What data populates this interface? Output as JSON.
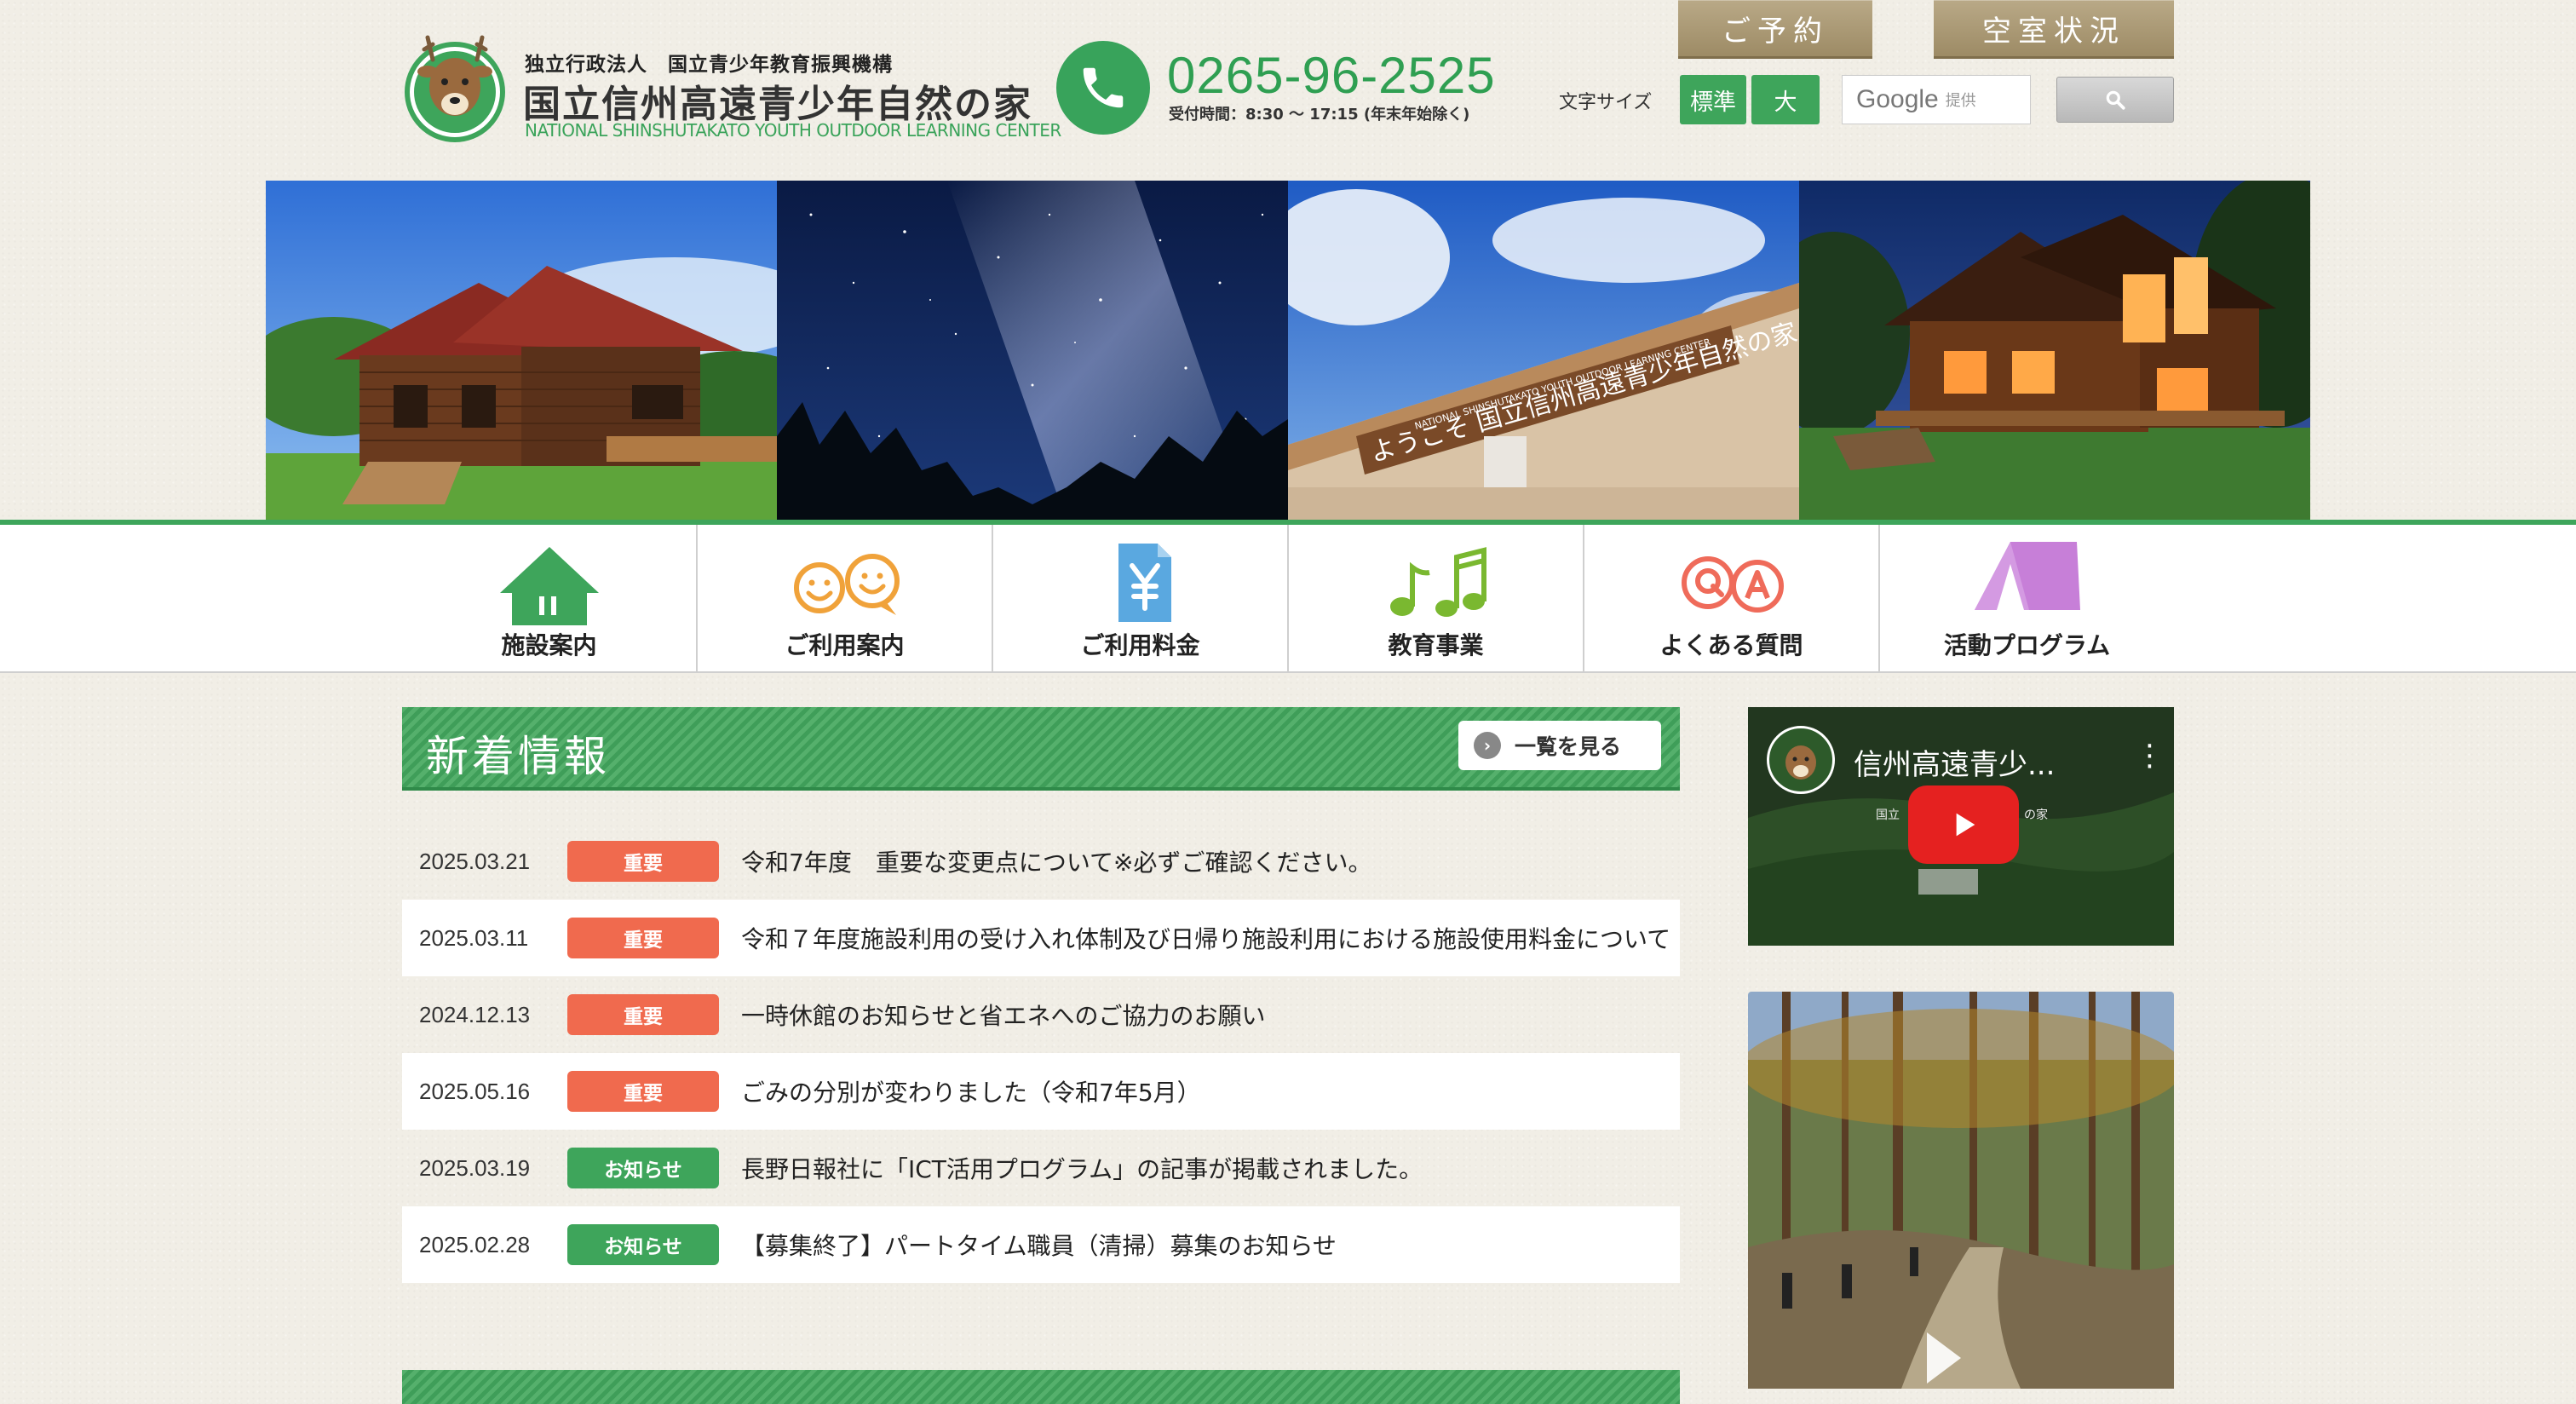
{
  "header": {
    "org_small": "独立行政法人　国立青少年教育振興機構",
    "org_title": "国立信州高遠青少年自然の家",
    "org_en": "NATIONAL SHINSHUTAKATO YOUTH OUTDOOR LEARNING CENTER",
    "phone_number": "0265-96-2525",
    "phone_hours": "受付時間：8:30 ～ 17:15 (年末年始除く)",
    "reserve_label": "ご予約",
    "vacancy_label": "空室状況",
    "fontsize_label": "文字サイズ",
    "fontsize_standard": "標準",
    "fontsize_large": "大",
    "search_brand": "Google",
    "search_sub": "提供"
  },
  "hero": {
    "sign_text": "ようこそ 国立信州高遠青少年自然の家",
    "sign_en": "NATIONAL SHINSHUTAKATO YOUTH OUTDOOR LEARNING CENTER"
  },
  "nav": {
    "items": [
      {
        "label": "施設案内",
        "icon": "house-icon"
      },
      {
        "label": "ご利用案内",
        "icon": "smiley-faces-icon"
      },
      {
        "label": "ご利用料金",
        "icon": "yen-document-icon"
      },
      {
        "label": "教育事業",
        "icon": "music-notes-icon"
      },
      {
        "label": "よくある質問",
        "icon": "qa-icon"
      },
      {
        "label": "活動プログラム",
        "icon": "tent-icon"
      }
    ]
  },
  "news": {
    "title": "新着情報",
    "more_label": "一覧を見る",
    "items": [
      {
        "date": "2025.03.21",
        "badge": "重要",
        "text": "令和7年度　重要な変更点について※必ずご確認ください。"
      },
      {
        "date": "2025.03.11",
        "badge": "重要",
        "text": "令和７年度施設利用の受け入れ体制及び日帰り施設利用における施設使用料金について"
      },
      {
        "date": "2024.12.13",
        "badge": "重要",
        "text": "一時休館のお知らせと省エネへのご協力のお願い"
      },
      {
        "date": "2025.05.16",
        "badge": "重要",
        "text": "ごみの分別が変わりました（令和7年5月）"
      },
      {
        "date": "2025.03.19",
        "badge": "お知らせ",
        "text": "長野日報社に「ICT活用プログラム」の記事が掲載されました。"
      },
      {
        "date": "2025.02.28",
        "badge": "お知らせ",
        "text": "【募集終了】パートタイム職員（清掃）募集のお知らせ"
      }
    ]
  },
  "video": {
    "title": "信州高遠青少...",
    "sub_left": "国立",
    "sub_right": "の家"
  },
  "colors": {
    "green": "#3ea55b",
    "important": "#f06a4e",
    "notice": "#3ea55b",
    "gold": "#ab9a76"
  }
}
